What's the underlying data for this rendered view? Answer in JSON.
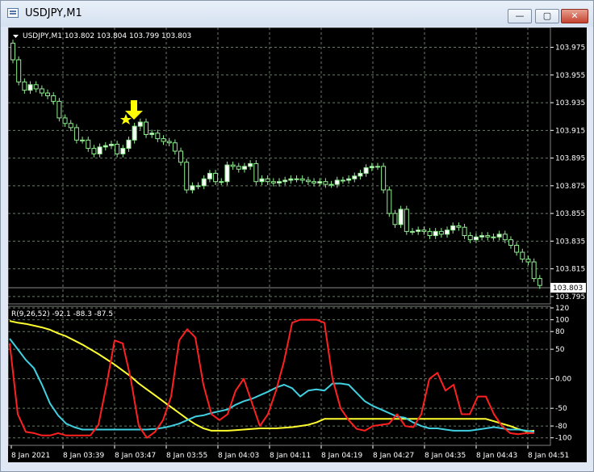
{
  "window": {
    "title": "USDJPY,M1",
    "buttons": {
      "minimize": "—",
      "maximize": "▢",
      "close": "✕"
    }
  },
  "price_panel": {
    "header": "USDJPY,M1  103.802 103.804 103.799 103.803",
    "current_price": "103.803",
    "y_ticks": [
      "103.975",
      "103.955",
      "103.935",
      "103.915",
      "103.895",
      "103.875",
      "103.855",
      "103.835",
      "103.815",
      "103.795"
    ],
    "arrow_symbol": "down-arrow",
    "star_symbol": "star",
    "colors": {
      "background": "#000000",
      "grid": "#6a7a6a",
      "candle": "#90ee90",
      "arrow": "#ffff00"
    }
  },
  "indicator_panel": {
    "header": "R(9,26,52) -92.1 -88.3 -87.5",
    "y_ticks": [
      "120",
      "100",
      "80",
      "50",
      "0.00",
      "-50",
      "-80",
      "-100"
    ],
    "colors": {
      "r9": "#ff2020",
      "r26": "#40d0e0",
      "r52": "#ffff30"
    }
  },
  "x_ticks": [
    "8 Jan 2021",
    "8 Jan 03:39",
    "8 Jan 03:47",
    "8 Jan 03:55",
    "8 Jan 04:03",
    "8 Jan 04:11",
    "8 Jan 04:19",
    "8 Jan 04:27",
    "8 Jan 04:35",
    "8 Jan 04:43",
    "8 Jan 04:51"
  ],
  "chart_data": [
    {
      "type": "candlestick",
      "title": "USDJPY,M1",
      "ylim": [
        103.792,
        103.987
      ],
      "close": [
        103.966,
        103.95,
        103.944,
        103.948,
        103.945,
        103.942,
        103.94,
        103.936,
        103.924,
        103.92,
        103.917,
        103.908,
        103.908,
        103.902,
        103.898,
        103.903,
        103.904,
        103.905,
        103.898,
        103.902,
        103.908,
        103.918,
        103.921,
        103.912,
        103.913,
        103.909,
        103.907,
        103.906,
        103.9,
        103.892,
        103.872,
        103.875,
        103.875,
        103.88,
        103.884,
        103.878,
        103.878,
        103.89,
        103.889,
        103.887,
        103.889,
        103.891,
        103.878,
        103.88,
        103.878,
        103.877,
        103.878,
        103.879,
        103.88,
        103.88,
        103.879,
        103.878,
        103.877,
        103.878,
        103.876,
        103.876,
        103.879,
        103.879,
        103.88,
        103.882,
        103.884,
        103.888,
        103.889,
        103.889,
        103.872,
        103.855,
        103.847,
        103.858,
        103.842,
        103.842,
        103.843,
        103.842,
        103.839,
        103.842,
        103.84,
        103.843,
        103.846,
        103.845,
        103.839,
        103.836,
        103.838,
        103.839,
        103.838,
        103.838,
        103.84,
        103.836,
        103.832,
        103.827,
        103.822,
        103.82,
        103.808,
        103.803
      ]
    },
    {
      "type": "line",
      "title": "R(9,26,52)",
      "ylim": [
        -110,
        120
      ],
      "x": [
        0,
        10,
        20,
        30,
        40,
        50,
        60,
        70,
        80,
        90,
        100,
        110,
        120,
        130,
        140,
        150,
        160,
        170,
        180,
        190,
        200,
        210,
        220,
        230,
        240,
        250,
        260,
        270,
        280,
        290,
        300,
        310,
        320,
        330,
        340,
        350,
        360,
        370,
        380,
        390,
        400,
        410,
        420,
        430,
        440,
        450,
        460,
        470,
        480,
        490,
        500,
        510,
        520,
        530,
        540,
        550,
        560,
        570,
        580,
        590,
        600,
        610,
        620,
        630,
        640,
        650
      ],
      "series": [
        {
          "name": "",
          "values": [
            98,
            95,
            93,
            90,
            87,
            83,
            77,
            72,
            65,
            58,
            50,
            42,
            33,
            24,
            14,
            4,
            -8,
            -18,
            -28,
            -38,
            -48,
            -58,
            -68,
            -77,
            -84,
            -88,
            -88,
            -88,
            -87,
            -86,
            -85,
            -84,
            -84,
            -84,
            -83,
            -82,
            -80,
            -78,
            -74,
            -68,
            -68,
            -68,
            -68,
            -68,
            -68,
            -68,
            -68,
            -68,
            -68,
            -68,
            -68,
            -68,
            -68,
            -68,
            -68,
            -68,
            -68,
            -68,
            -68,
            -68,
            -72,
            -76,
            -80,
            -85,
            -89,
            -88
          ]
        },
        {
          "name": "",
          "values": [
            68,
            50,
            32,
            18,
            -10,
            -42,
            -62,
            -76,
            -82,
            -86,
            -86,
            -86,
            -86,
            -86,
            -86,
            -86,
            -86,
            -86,
            -85,
            -83,
            -80,
            -76,
            -70,
            -64,
            -62,
            -58,
            -55,
            -52,
            -44,
            -38,
            -34,
            -28,
            -22,
            -15,
            -10,
            -16,
            -30,
            -20,
            -18,
            -20,
            -8,
            -8,
            -10,
            -24,
            -38,
            -46,
            -52,
            -58,
            -64,
            -66,
            -74,
            -80,
            -84,
            -84,
            -86,
            -88,
            -88,
            -88,
            -86,
            -84,
            -82,
            -84,
            -86,
            -86,
            -88,
            -90
          ]
        },
        {
          "name": "",
          "values": [
            60,
            -60,
            -90,
            -92,
            -96,
            -96,
            -92,
            -96,
            -96,
            -96,
            -96,
            -78,
            -10,
            65,
            60,
            0,
            -80,
            -100,
            -90,
            -70,
            -30,
            65,
            84,
            70,
            -10,
            -60,
            -70,
            -60,
            -20,
            0,
            -40,
            -80,
            -60,
            -20,
            30,
            95,
            100,
            100,
            100,
            95,
            0,
            -50,
            -70,
            -85,
            -88,
            -80,
            -78,
            -76,
            -60,
            -80,
            -82,
            -60,
            0,
            10,
            -20,
            -10,
            -60,
            -60,
            -30,
            -30,
            -60,
            -80,
            -92,
            -94,
            -92,
            -92
          ]
        }
      ]
    }
  ]
}
